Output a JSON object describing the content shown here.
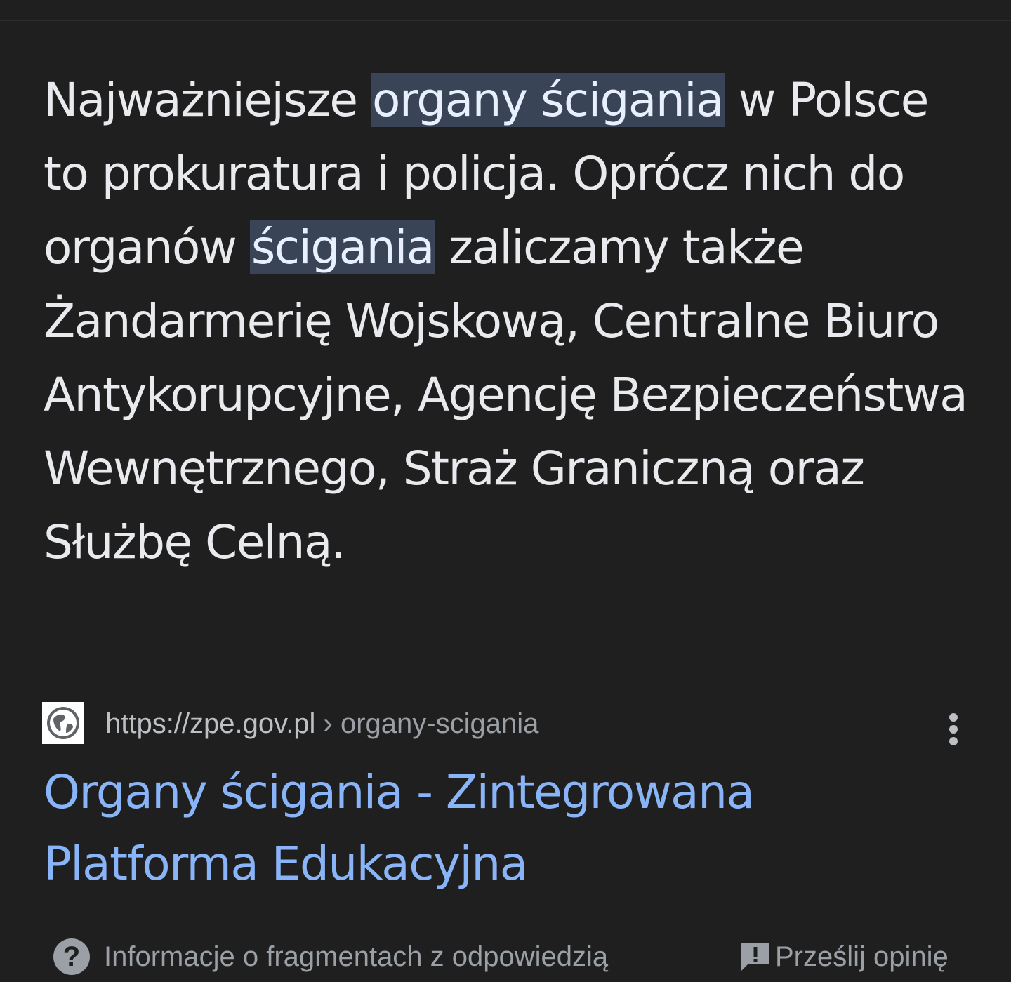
{
  "snippet": {
    "part1": "Najważniejsze ",
    "highlight1": "organy ścigania",
    "part2": " w Polsce to prokuratura i policja. Oprócz nich do organów ",
    "highlight2": "ścigania",
    "part3": " zaliczamy także Żandarmerię Wojskową, Centralne Biuro Antykorupcyjne, Agencję Bezpieczeństwa Wewnętrznego, Straż Graniczną oraz Służbę Celną."
  },
  "source": {
    "favicon_icon": "globe-icon",
    "url_domain": "https://zpe.gov.pl",
    "url_separator": " › ",
    "url_path": "organy-scigania",
    "more_icon": "more-vert-icon"
  },
  "result": {
    "title": "Organy ścigania - Zintegrowana Platforma Edukacyjna"
  },
  "footer": {
    "about_icon": "help-circle-icon",
    "about_label": "Informacje o fragmentach z odpowiedzią",
    "feedback_icon": "feedback-icon",
    "feedback_label": "Prześlij opinię"
  },
  "colors": {
    "background": "#1f1f1f",
    "text": "#e8eaed",
    "highlight_bg": "#394457",
    "link": "#8ab4f8",
    "secondary": "#9aa0a6"
  }
}
